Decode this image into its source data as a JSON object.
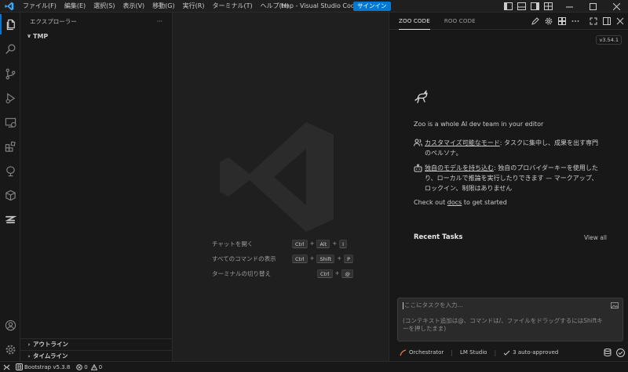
{
  "titlebar": {
    "menus": [
      "ファイル(F)",
      "編集(E)",
      "選択(S)",
      "表示(V)",
      "移動(G)",
      "実行(R)",
      "ターミナル(T)",
      "ヘルプ(H)"
    ],
    "title": "tmp - Visual Studio Code",
    "signin": "サインイン"
  },
  "sidebar": {
    "header": "エクスプローラー",
    "more": "···",
    "folder": "TMP",
    "outline": "アウトライン",
    "timeline": "タイムライン"
  },
  "editor": {
    "shortcuts": [
      {
        "label": "チャットを開く",
        "keys": [
          "Ctrl",
          "Alt",
          "I"
        ]
      },
      {
        "label": "すべてのコマンドの表示",
        "keys": [
          "Ctrl",
          "Shift",
          "P"
        ]
      },
      {
        "label": "ターミナルの切り替え",
        "keys": [
          "Ctrl",
          "@"
        ]
      }
    ]
  },
  "panel": {
    "tabs": [
      "ZOO CODE",
      "ROO CODE"
    ],
    "version": "v3.54.1",
    "intro": "Zoo is a whole AI dev team in your editor",
    "feature1_link": "カスタマイズ可能なモード",
    "feature1_text": ": タスクに集中し、成果を出す専門のペルソナ。",
    "feature2_link": "独自のモデルを持ち込む",
    "feature2_text": ": 独自のプロバイダーキーを使用したり、ローカルで推論を実行したりできます — マークアップ、ロックイン、制限はありません",
    "checkout_pre": "Check out ",
    "checkout_link": "docs",
    "checkout_post": " to get started",
    "recent_tasks": "Recent Tasks",
    "view_all": "View all",
    "chat_placeholder": "ここにタスクを入力...",
    "chat_hint": "(コンテキスト追加は@、コマンドは/、ファイルをドラッグするにはShiftキーを押したまま)",
    "mode": "Orchestrator",
    "provider": "LM Studio",
    "auto_approved": "3 auto-approved"
  },
  "statusbar": {
    "bootstrap": "Bootstrap v5.3.8",
    "errors": "0",
    "warnings": "0"
  },
  "colors": {
    "accent": "#0078d4",
    "bg": "#1f1f1f",
    "sidebar_bg": "#181818"
  }
}
